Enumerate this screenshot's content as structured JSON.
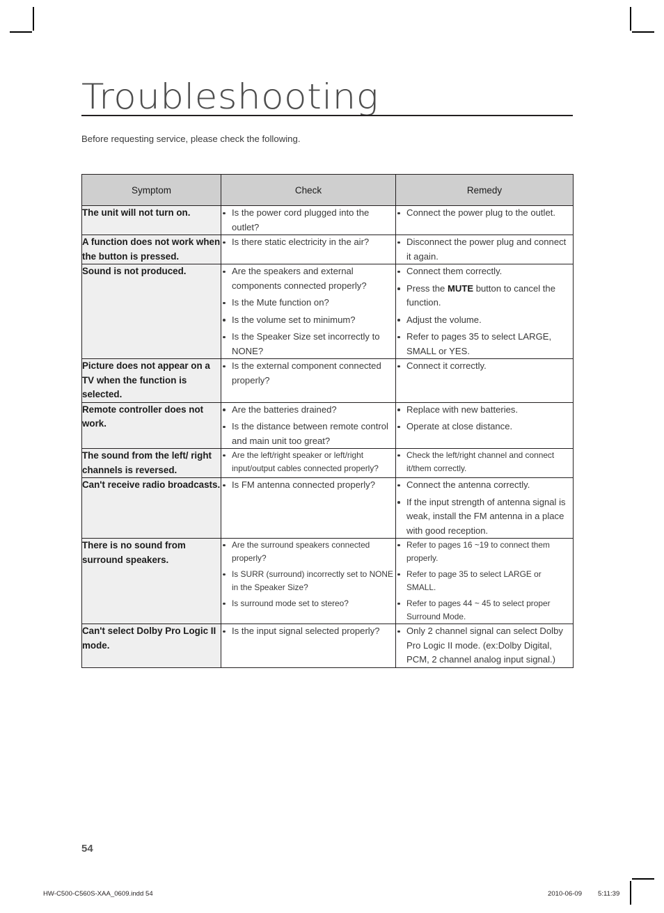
{
  "document": {
    "title": "Troubleshooting",
    "intro": "Before requesting service, please check the following.",
    "page_number": "54"
  },
  "table": {
    "headers": {
      "symptom": "Symptom",
      "check": "Check",
      "remedy": "Remedy"
    },
    "rows": [
      {
        "symptom": "The unit will not turn on.",
        "check": [
          "Is the power cord plugged into the outlet?"
        ],
        "remedy": [
          "Connect the power plug to the outlet."
        ]
      },
      {
        "symptom": "A function does not work when the button is pressed.",
        "check": [
          "Is there static electricity in the air?"
        ],
        "remedy": [
          "Disconnect the power plug and connect it again."
        ]
      },
      {
        "symptom": "Sound is not produced.",
        "check": [
          "Are the speakers and external components connected properly?",
          "Is the Mute function on?",
          "Is the volume set to minimum?",
          "Is the Speaker Size set incorrectly to NONE?"
        ],
        "remedy": [
          "Connect them correctly.",
          "Press the MUTE button to cancel the function.",
          "Adjust the volume.",
          "Refer to pages 35 to select LARGE, SMALL or YES."
        ],
        "remedy_bold": [
          "",
          "MUTE",
          "",
          ""
        ]
      },
      {
        "symptom": "Picture does not appear on a TV when the function is selected.",
        "check": [
          "Is the external component connected properly?"
        ],
        "remedy": [
          "Connect it correctly."
        ]
      },
      {
        "symptom": "Remote controller does not work.",
        "check": [
          "Are the batteries drained?",
          "Is the distance between remote control and main unit too great?"
        ],
        "remedy": [
          "Replace with new batteries.",
          "Operate at close distance."
        ]
      },
      {
        "symptom": "The sound from the left/ right channels is reversed.",
        "check": [
          "Are the left/right speaker or left/right input/output cables connected properly?"
        ],
        "remedy": [
          "Check the left/right channel and connect it/them correctly."
        ]
      },
      {
        "symptom": "Can't receive radio broadcasts.",
        "check": [
          "Is FM antenna connected properly?"
        ],
        "remedy": [
          "Connect the antenna correctly.",
          "If the input strength of antenna signal is weak, install the FM antenna in a place with good reception."
        ]
      },
      {
        "symptom": "There is no sound from surround speakers.",
        "check": [
          "Are the surround speakers connected properly?",
          "Is SURR (surround) incorrectly set to NONE in the Speaker Size?",
          "Is surround mode set to stereo?"
        ],
        "remedy": [
          "Refer to pages 16 ~19 to connect them properly.",
          "Refer to page 35 to select LARGE or SMALL.",
          "Refer to pages 44 ~ 45 to select proper Surround Mode."
        ]
      },
      {
        "symptom": "Can't select Dolby Pro Logic II mode.",
        "check": [
          "Is the input signal selected properly?"
        ],
        "remedy": [
          "Only 2 channel signal can select Dolby Pro Logic II mode. (ex:Dolby Digital, PCM, 2 channel analog input signal.)"
        ]
      }
    ]
  },
  "footer": {
    "file_name": "HW-C500-C560S-XAA_0609.indd   54",
    "date": "2010-06-09",
    "time": "5:11:39"
  }
}
